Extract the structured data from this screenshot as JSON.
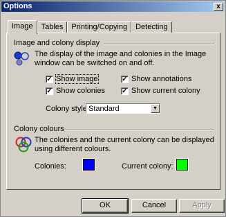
{
  "window": {
    "title": "Options",
    "close_label": "x"
  },
  "tabs": [
    {
      "label": "Image",
      "active": true
    },
    {
      "label": "Tables",
      "active": false
    },
    {
      "label": "Printing/Copying",
      "active": false
    },
    {
      "label": "Detecting",
      "active": false
    }
  ],
  "image_group": {
    "title": "Image and colony display",
    "icon": "colony-dots-icon",
    "description": "The display of the image and colonies in the Image window can be switched on and off.",
    "checkboxes": {
      "show_image": {
        "label": "Show image",
        "checked": true
      },
      "show_annotations": {
        "label": "Show annotations",
        "checked": true
      },
      "show_colonies": {
        "label": "Show colonies",
        "checked": true
      },
      "show_current_colony": {
        "label": "Show current colony",
        "checked": true
      }
    },
    "colony_style": {
      "label": "Colony style:",
      "value": "Standard"
    }
  },
  "colour_group": {
    "title": "Colony colours",
    "icon": "overlapping-rings-icon",
    "description": "The colonies and the current colony can be displayed using different colours.",
    "colonies": {
      "label": "Colonies:",
      "color": "#0000ff"
    },
    "current_colony": {
      "label": "Current colony:",
      "color": "#00ff00"
    }
  },
  "buttons": {
    "ok": "OK",
    "cancel": "Cancel",
    "apply": "Apply"
  }
}
